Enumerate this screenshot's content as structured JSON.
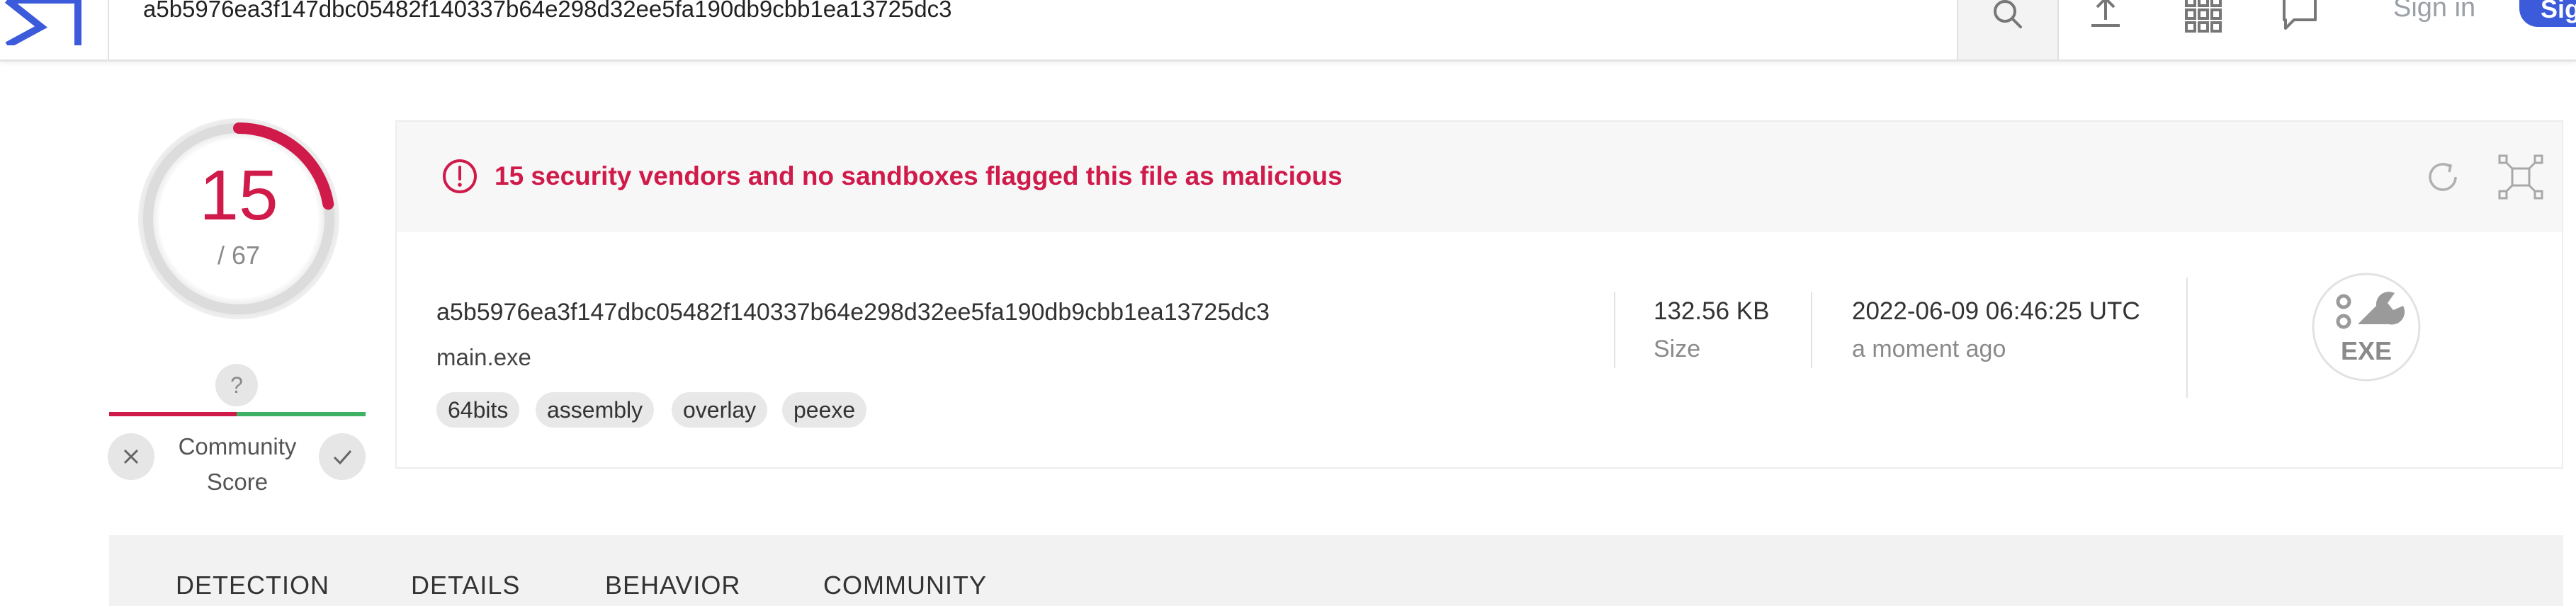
{
  "topbar": {
    "search_value": "a5b5976ea3f147dbc05482f140337b64e298d32ee5fa190db9cbb1ea13725dc3",
    "sign_in": "Sign in",
    "sign_up": "Sign up",
    "icons": [
      "search-icon",
      "upload-icon",
      "apps-grid-icon",
      "chat-icon"
    ]
  },
  "score": {
    "detections": "15",
    "total": "/ 67",
    "fraction": 0.224,
    "community_question": "?",
    "community_label_1": "Community",
    "community_label_2": "Score"
  },
  "alert": {
    "text": "15 security vendors and no sandboxes flagged this file as malicious"
  },
  "file": {
    "hash": "a5b5976ea3f147dbc05482f140337b64e298d32ee5fa190db9cbb1ea13725dc3",
    "name": "main.exe",
    "tags": [
      "64bits",
      "assembly",
      "overlay",
      "peexe"
    ],
    "size_value": "132.56 KB",
    "size_label": "Size",
    "date_value": "2022-06-09 06:46:25 UTC",
    "date_label": "a moment ago",
    "type_badge": "EXE"
  },
  "tabs": [
    "DETECTION",
    "DETAILS",
    "BEHAVIOR",
    "COMMUNITY"
  ],
  "colors": {
    "malicious": "#cf1a4a",
    "harmless": "#3fb163",
    "brand": "#3b5bdb"
  }
}
